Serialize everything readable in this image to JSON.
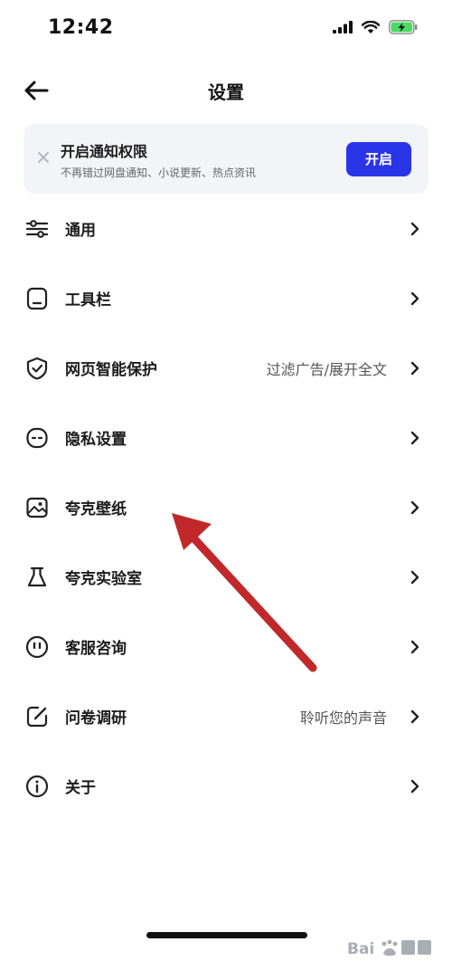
{
  "status": {
    "time": "12:42"
  },
  "nav": {
    "title": "设置"
  },
  "notice": {
    "title": "开启通知权限",
    "subtitle": "不再错过网盘通知、小说更新、热点资讯",
    "button_label": "开启",
    "button_color": "#2b35e8"
  },
  "menu": {
    "items": [
      {
        "label": "通用",
        "value": "",
        "icon": "sliders-icon"
      },
      {
        "label": "工具栏",
        "value": "",
        "icon": "toolbar-icon"
      },
      {
        "label": "网页智能保护",
        "value": "过滤广告/展开全文",
        "icon": "shield-check-icon"
      },
      {
        "label": "隐私设置",
        "value": "",
        "icon": "privacy-face-icon"
      },
      {
        "label": "夸克壁纸",
        "value": "",
        "icon": "wallpaper-image-icon"
      },
      {
        "label": "夸克实验室",
        "value": "",
        "icon": "lab-flask-icon"
      },
      {
        "label": "客服咨询",
        "value": "",
        "icon": "support-face-icon"
      },
      {
        "label": "问卷调研",
        "value": "聆听您的声音",
        "icon": "survey-edit-icon"
      },
      {
        "label": "关于",
        "value": "",
        "icon": "info-icon"
      }
    ]
  },
  "annotation": {
    "arrow_color": "#c0282a"
  }
}
